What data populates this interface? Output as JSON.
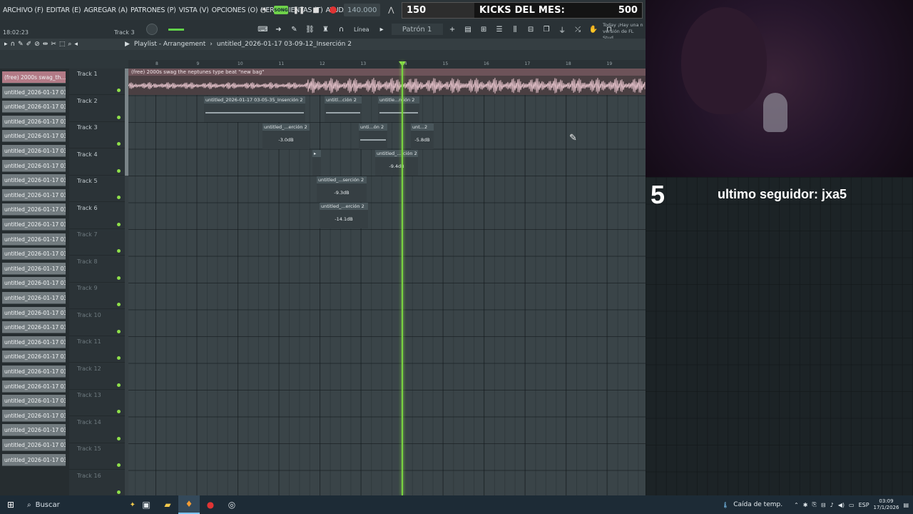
{
  "menu": {
    "items": [
      "ARCHIVO (F)",
      "EDITAR (E)",
      "AGREGAR (A)",
      "PATRONES (P)",
      "VISTA (V)",
      "OPCIONES (O)",
      "HERRAMIENTAS (T)",
      "AYUDA"
    ]
  },
  "transport": {
    "song_label": "SONG",
    "tempo": "140.000"
  },
  "goal": {
    "current": "150",
    "title": "KICKS DEL MES:",
    "target": "500",
    "progress_fraction": 0.3
  },
  "status": {
    "clock": "18:02:23",
    "hint_track": "Track 3"
  },
  "toolbar": {
    "snap": "Línea",
    "pattern": "Patrón 1",
    "news_line1": "Today  ¡Hay una n",
    "news_line2": "versión de FL Stud"
  },
  "playlist": {
    "title": "Playlist - Arrangement",
    "separator": "›",
    "file": "untitled_2026-01-17 03-09-12_Inserción 2"
  },
  "ruler": [
    "8",
    "9",
    "10",
    "11",
    "12",
    "13",
    "14",
    "15",
    "16",
    "17",
    "18",
    "19"
  ],
  "clip_list": [
    "(free) 2000s swag_th...",
    "untitled_2026-01-17 03-...",
    "untitled_2026-01-17 03-...",
    "untitled_2026-01-17 03-...",
    "untitled_2026-01-17 03-...",
    "untitled_2026-01-17 03-...",
    "untitled_2026-01-17 03-...",
    "untitled_2026-01-17 03-...",
    "untitled_2026-01-17 03-...",
    "untitled_2026-01-17 03-...",
    "untitled_2026-01-17 03-...",
    "untitled_2026-01-17 03-...",
    "untitled_2026-01-17 03-...",
    "untitled_2026-01-17 03-...",
    "untitled_2026-01-17 03-...",
    "untitled_2026-01-17 03-...",
    "untitled_2026-01-17 03-...",
    "untitled_2026-01-17 03-...",
    "untitled_2026-01-17 03-...",
    "untitled_2026-01-17 03-...",
    "untitled_2026-01-17 03-...",
    "untitled_2026-01-17 03-...",
    "untitled_2026-01-17 03-...",
    "untitled_2026-01-17 03-...",
    "untitled_2026-01-17 03-...",
    "untitled_2026-01-17 03-...",
    "untitled_2026-01-17 03-..."
  ],
  "tracks": [
    "Track 1",
    "Track 2",
    "Track 3",
    "Track 4",
    "Track 5",
    "Track 6",
    "Track 7",
    "Track 8",
    "Track 9",
    "Track 10",
    "Track 11",
    "Track 12",
    "Track 13",
    "Track 14",
    "Track 15",
    "Track 16"
  ],
  "clips": {
    "audio1": "(free) 2000s swag  the neptunes type beat  \"new bag\"",
    "t2a": "untitled_2026-01-17 03-05-35_Inserción 2",
    "t2b": "untitl...ción 2",
    "t2c": "untitle...rción 2",
    "t3a": "untitled_...erción 2",
    "t3a_db": "-3.0dB",
    "t3b": "unti...ón 2",
    "t3c": "unt...2",
    "t3c_db": "-5.8dB",
    "t4b": "untitled_...rción 2",
    "t4b_db": "-9.4dB",
    "t5": "untitled_...serción 2",
    "t5_db": "-9.3dB",
    "t6": "untitled_...erción 2",
    "t6_db": "-14.1dB"
  },
  "overlay": {
    "number": "5",
    "follower": "ultimo seguidor: jxa5"
  },
  "taskbar": {
    "search": "Buscar",
    "weather": "Caída de temp.",
    "lang": "ESP",
    "time": "03:09",
    "date": "17/1/2026"
  }
}
